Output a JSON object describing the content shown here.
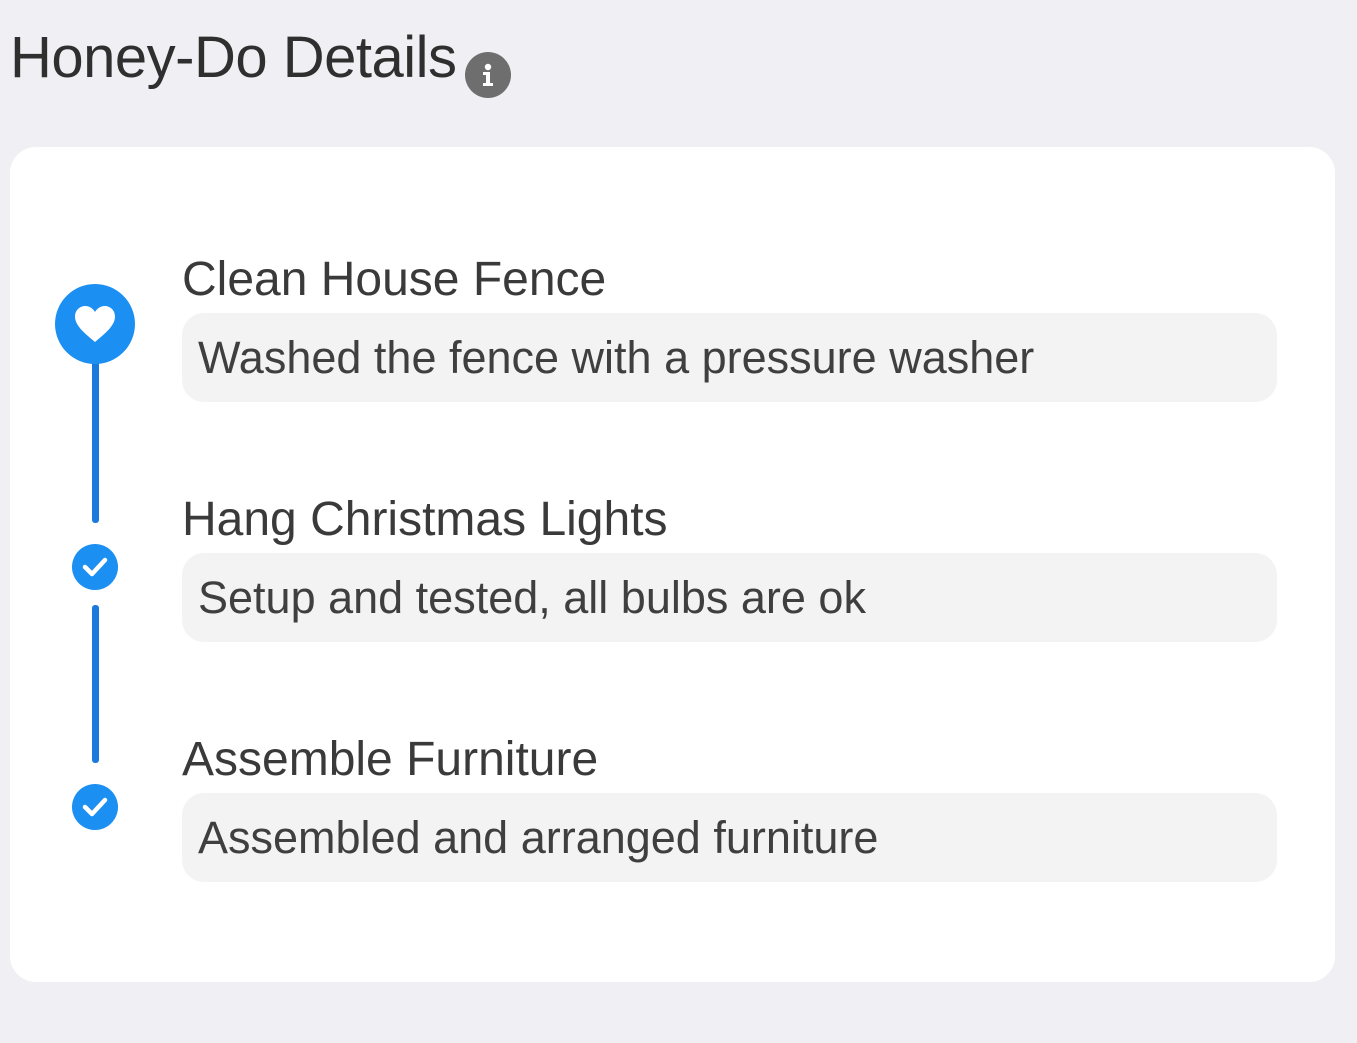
{
  "header": {
    "title": "Honey-Do Details",
    "info_icon": "info-icon"
  },
  "colors": {
    "accent": "#1b8ff2",
    "line": "#1b7bdc",
    "background": "#f0f0f4",
    "card": "#ffffff",
    "field": "#f3f3f3"
  },
  "timeline": {
    "items": [
      {
        "title": "Clean House Fence",
        "description": "Washed the fence with a pressure washer",
        "icon": "heart-icon",
        "status": "current"
      },
      {
        "title": "Hang Christmas Lights",
        "description": "Setup and tested, all bulbs are ok",
        "icon": "checkmark-icon",
        "status": "completed"
      },
      {
        "title": "Assemble Furniture",
        "description": "Assembled and arranged furniture",
        "icon": "checkmark-icon",
        "status": "completed"
      }
    ]
  }
}
